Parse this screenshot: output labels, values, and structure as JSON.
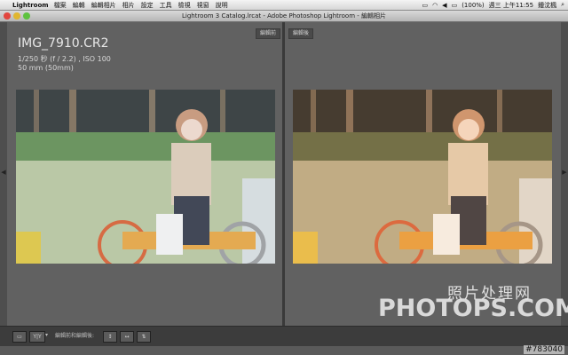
{
  "menubar": {
    "app": "Lightroom",
    "items": [
      "檔案",
      "編輯",
      "編輯相片",
      "相片",
      "設定",
      "工具",
      "檢視",
      "視窗",
      "說明"
    ],
    "battery": "(100%)",
    "clock": "週三 上午11:55",
    "user": "鍾沈楓"
  },
  "window": {
    "title": "Lightroom 3 Catalog.lrcat - Adobe Photoshop Lightroom - 編輯相片"
  },
  "panels": {
    "before_label": "編輯前",
    "after_label": "編輯後"
  },
  "photo_info": {
    "filename": "IMG_7910.CR2",
    "exposure": "1/250 秒 (f / 2.2) , ISO 100",
    "focal": "50 mm (50mm)"
  },
  "toolbar": {
    "view_label": "Y|Y",
    "compare_label": "編輯前和編輯後:",
    "btn1": "↕",
    "btn2": "↔",
    "btn3": "⇅"
  },
  "watermark": {
    "cn": "照片处理网",
    "en": "PHOTOPS.COM"
  },
  "stamp": "#783040",
  "colors": {
    "before_tint": "#cfe6ff",
    "after_tint": "#ffd9b0"
  }
}
